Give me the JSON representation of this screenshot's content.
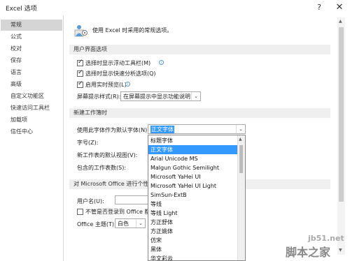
{
  "window": {
    "title": "Excel 选项",
    "help": "?",
    "close": "✕"
  },
  "sidebar": {
    "items": [
      {
        "label": "常规",
        "active": true
      },
      {
        "label": "公式"
      },
      {
        "label": "校对"
      },
      {
        "label": "保存"
      },
      {
        "label": "语言"
      },
      {
        "label": "高级"
      },
      {
        "label": "自定义功能区"
      },
      {
        "label": "快速访问工具栏"
      },
      {
        "label": "加载项"
      },
      {
        "label": "信任中心"
      }
    ]
  },
  "header": {
    "text": "使用 Excel 时采用的常规选项。"
  },
  "sections": {
    "ui": "用户界面选项",
    "new_workbook": "新建工作簿时",
    "office": "对 Microsoft Office 进行个性"
  },
  "ui_options": {
    "mini_toolbar": "选择时显示浮动工具栏(M)",
    "quick_analysis": "选择时显示快速分析选项(Q)",
    "live_preview": "启用实时预览(L)",
    "tooltip_label": "屏幕提示样式(R):",
    "tooltip_value": "在屏幕提示中显示功能说明"
  },
  "new_workbook": {
    "font_label": "使用此字体作为默认字体(N):",
    "font_value": "正文字体",
    "size_label": "字号(Z):",
    "view_label": "新工作表的默认视图(V):",
    "sheets_label": "包含的工作表数(S):"
  },
  "office": {
    "username_label": "用户名(U):",
    "always_use_label": "不管是否登录到 Office 都",
    "theme_label": "Office 主题(T):",
    "theme_value": "白色"
  },
  "font_dropdown": [
    "标题字体",
    "正文字体",
    "Arial Unicode MS",
    "Malgun Gothic Semilight",
    "Microsoft YaHei UI",
    "Microsoft YaHei UI Light",
    "SimSun-ExtB",
    "等线",
    "等线 Light",
    "方正舒体",
    "方正姚体",
    "仿宋",
    "黑体",
    "华文彩云"
  ],
  "watermark": {
    "line1": "jb51.net",
    "line2": "脚本之家"
  }
}
